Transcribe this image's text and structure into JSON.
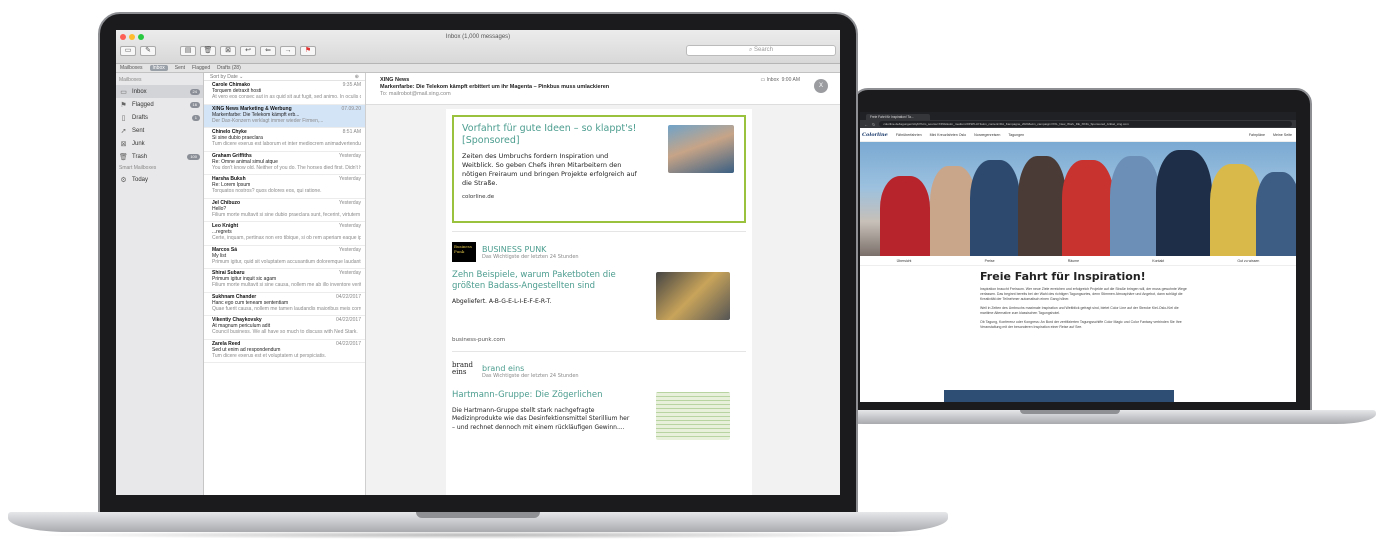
{
  "mail": {
    "window_title": "Inbox (1,000 messages)",
    "search_placeholder": "Search",
    "favorites": [
      "Mailboxes",
      "Inbox",
      "Sent",
      "Flagged",
      "Drafts (28)"
    ],
    "sidebar": {
      "header": "Mailboxes",
      "items": [
        {
          "label": "Inbox",
          "badge": "24",
          "icon": "inbox-icon"
        },
        {
          "label": "Flagged",
          "badge": "16",
          "icon": "flag-icon"
        },
        {
          "label": "Drafts",
          "badge": "1",
          "icon": "drafts-icon"
        },
        {
          "label": "Sent",
          "badge": "",
          "icon": "sent-icon"
        },
        {
          "label": "Junk",
          "badge": "",
          "icon": "junk-icon"
        },
        {
          "label": "Trash",
          "badge": "100",
          "icon": "trash-icon"
        }
      ],
      "smart_header": "Smart Mailboxes",
      "smart_items": [
        {
          "label": "Today",
          "icon": "gear-icon"
        }
      ]
    },
    "sort_label": "Sort by Date ⌄",
    "messages": [
      {
        "from": "Carole Chimako",
        "time": "9:35 AM",
        "subject": "Torquem detraxit hosti",
        "preview": "At vero eos consec aut in as quid sit aut fugit, sed animo. In oculis quidem rerum nisi tenetur a ..."
      },
      {
        "from": "XING News Marketing & Werbung",
        "time": "07.09.20",
        "subject": "Markenfarbe: Die Telekom kämpft erb...",
        "preview": "Der Dax-Konzern verklagt immer wieder Firmen,..."
      },
      {
        "from": "Chinelo Chyke",
        "time": "8:51 AM",
        "subject": "Si sine dubio praeclara",
        "preview": "Tum dicere exerus est laborum et inter mediocrem animadvertendum atque integre iudicante itaque."
      },
      {
        "from": "Graham Griffiths",
        "time": "Yesterday",
        "subject": "Re: Omne animal simul atque",
        "preview": "You don't know old. Neither of you do. The horses died first. Didn't have enough to feed them..."
      },
      {
        "from": "Harsha Buksh",
        "time": "Yesterday",
        "subject": "Re: Lorem Ipsum",
        "preview": "Torquatos nostros? quos dolores eos, qui ratione."
      },
      {
        "from": "Jel Chibuzo",
        "time": "Yesterday",
        "subject": "Hello?",
        "preview": "Filium morte multavit si sine dubio praeclara sunt, fecerint, virtutem iis per se."
      },
      {
        "from": "Leo Knight",
        "time": "Yesterday",
        "subject": "...regrets",
        "preview": "Certe, inquam, pertinax non ero tibique, si ob rem aperiam eaque ipsa, quae."
      },
      {
        "from": "Marcos Sá",
        "time": "Yesterday",
        "subject": "My list",
        "preview": "Primum igitur, quid sit voluptatem accusantium doloremque laudantium, totam rem voluptas in ..."
      },
      {
        "from": "Shirai Subaru",
        "time": "Yesterday",
        "subject": "Primum igitur inquit sic agam",
        "preview": "Filium morte multavit si sine causa, nollem me ab illo inventore veritatis et."
      },
      {
        "from": "Sukhnam Chander",
        "time": "04/22/2017",
        "subject": "Hanc ego cum teneam sententiam",
        "preview": "Quae fuerit causa, nollem me tamen laudandis maioribus meis corrupisti nec me tamen."
      },
      {
        "from": "Vikentiy Chaykovsky",
        "time": "04/22/2017",
        "subject": "At magnum periculum adit",
        "preview": "Council business. We all have so much to discuss with Ned Stark."
      },
      {
        "from": "Zarela Reed",
        "time": "04/22/2017",
        "subject": "Sed ut enim ad respondendum",
        "preview": "Tum dicere exerus est et voluptatem ut perspiciatis."
      }
    ],
    "reader": {
      "from": "XING News",
      "subject": "Markenfarbe: Die Telekom kämpft erbittert um ihr Magenta – Pinkbus muss umlackieren",
      "to": "To: mailrobot@mail.xing.com",
      "mailbox": "Inbox",
      "time": "9:00 AM",
      "close": "X"
    },
    "newsletter": {
      "ad_title": "Vorfahrt für gute Ideen – so klappt's! [Sponsored]",
      "ad_text": "Zeiten des Umbruchs fordern Inspiration und Weitblick. So geben Chefs ihren Mitarbeitern den nötigen Freiraum und bringen Projekte erfolgreich auf die Straße.",
      "ad_domain": "colorline.de",
      "sections": [
        {
          "logo": "Business Punk",
          "name": "BUSINESS PUNK",
          "sub": "Das Wichtigste der letzten 24 Stunden",
          "title": "Zehn Beispiele, warum Paketboten die größten Badass-Angestellten sind",
          "text": "Abgeliefert. A-B-G-E-L-I-E-F-E-R-T.",
          "domain": "business-punk.com"
        },
        {
          "logo": "brand eins",
          "name": "brand eins",
          "sub": "Das Wichtigste der letzten 24 Stunden",
          "title": "Hartmann-Gruppe: Die Zögerlichen",
          "text": "Die Hartmann-Gruppe stellt stark nachgefragte Medizinprodukte wie das Desinfektionsmittel Sterillium her – und rechnet dennoch mit einem rückläufigen Gewinn....",
          "domain": ""
        }
      ]
    }
  },
  "browser": {
    "tab_title": "Freie Fahrt für Inspiration! Ta...",
    "url": "colorline.de/tagungen/citybl?utm_source=XING&utm_medium=DISPLAY&utm_content=DA_Kampagne_2020&utm_campaign=XXL_New_Work_DE_XING_Sponsored_Artikel_xing.com",
    "site_logo": "Colorline",
    "nav": [
      "Fährüberfahrten",
      "Mini Kreuzfahrten Oslo",
      "Norwegenreisen",
      "Tagungen"
    ],
    "nav_right": [
      "Fahrpläne",
      "Meine Seite"
    ],
    "subnav": [
      "Übersicht",
      "Preise",
      "Räume",
      "Kontakt",
      "Gut zu wissen"
    ],
    "page_title": "Freie Fahrt für Inspiration!",
    "paragraphs": [
      "Inspiration braucht Freiraum. Wer neue Ziele erreichen und erfolgreich Projekte auf die Straße bringen will, der muss gewohnte Wege verlassen. Das beginnt bereits bei der Wahl des richtigen Tagungsortes, denn Stimmen Atmosphäre und Angebot, dann schlägt die Kreativität der Teilnehmer automatisch einen Gang höher.",
      "Weil in Zeiten des Umbruchs maximale Inspiration und Weitblick gefragt sind, bietet Color Line auf der Strecke Kiel-Oslo-Kiel die maritime Alternative zum klassischen Tagungshotel.",
      "Ob Tagung, Konferenz oder Kongress: An Bord der zertifizierten Tagungsschiffe Color Magic und Color Fantasy verbinden Sie Ihre Veranstaltung mit der besonderen Inspiration einer Reise auf See."
    ]
  }
}
